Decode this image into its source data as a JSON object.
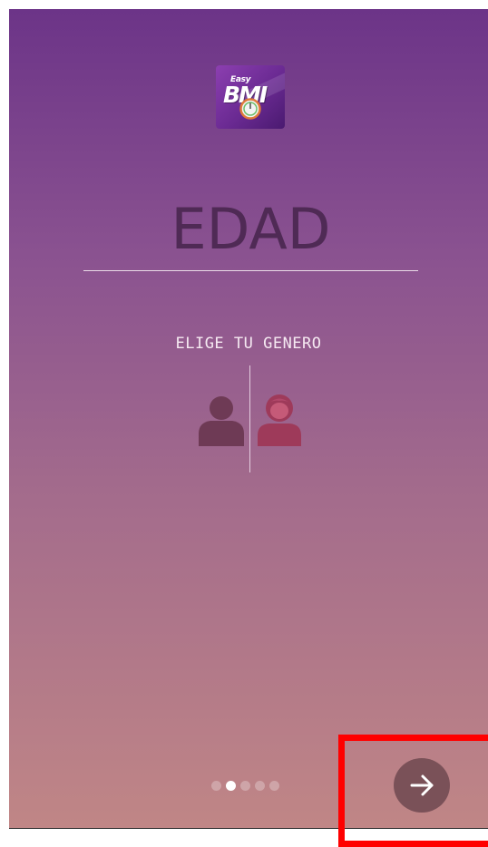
{
  "app": {
    "logo_easy": "Easy",
    "logo_bmi": "BMI"
  },
  "age": {
    "placeholder": "EDAD",
    "value": ""
  },
  "gender": {
    "prompt": "ELIGE TU GENERO",
    "options": [
      {
        "id": "male",
        "icon": "male-user-icon",
        "color": "#6e3a55"
      },
      {
        "id": "female",
        "icon": "female-user-icon",
        "color": "#9e3a5a"
      }
    ]
  },
  "pager": {
    "total": 5,
    "active_index": 1
  },
  "next": {
    "icon": "arrow-right-icon"
  },
  "colors": {
    "gradient_top": "#6c3488",
    "gradient_bottom": "#c08686",
    "next_button": "#7a5158",
    "highlight": "#ff0000"
  }
}
